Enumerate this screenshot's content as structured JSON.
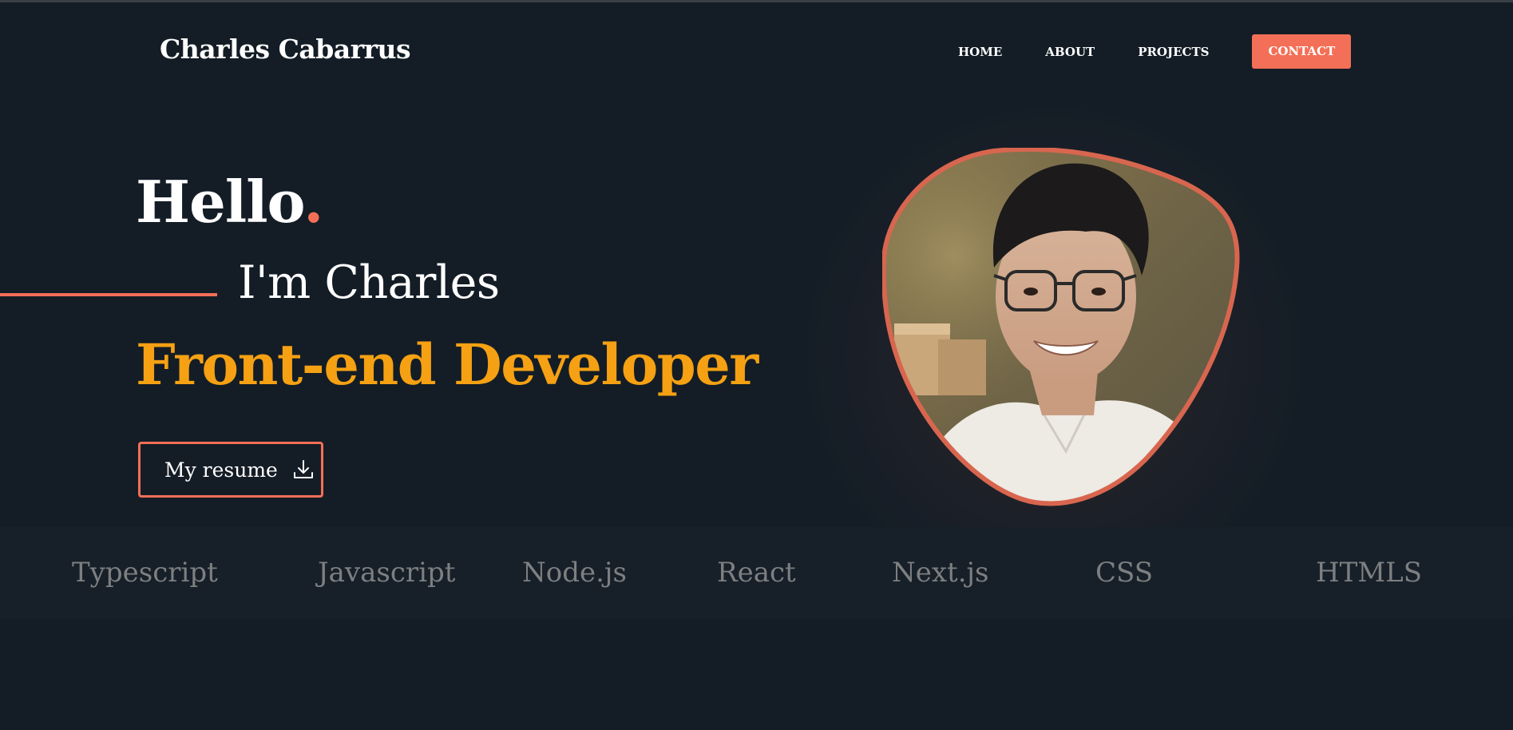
{
  "header": {
    "brand": "Charles Cabarrus",
    "nav": [
      {
        "label": "HOME"
      },
      {
        "label": "ABOUT"
      },
      {
        "label": "PROJECTS"
      }
    ],
    "contact_label": "CONTACT"
  },
  "hero": {
    "hello": "Hello",
    "hello_dot": ".",
    "intro": "I'm Charles",
    "role": "Front-end Developer",
    "resume_label": "My resume",
    "resume_icon": "download-icon"
  },
  "skills": [
    "Typescript",
    "Javascript",
    "Node.js",
    "React",
    "Next.js",
    "CSS",
    "HTMLS"
  ],
  "colors": {
    "background": "#141d26",
    "accent": "#f46f57",
    "highlight": "#f5a113",
    "muted_text": "#7d7f81"
  }
}
